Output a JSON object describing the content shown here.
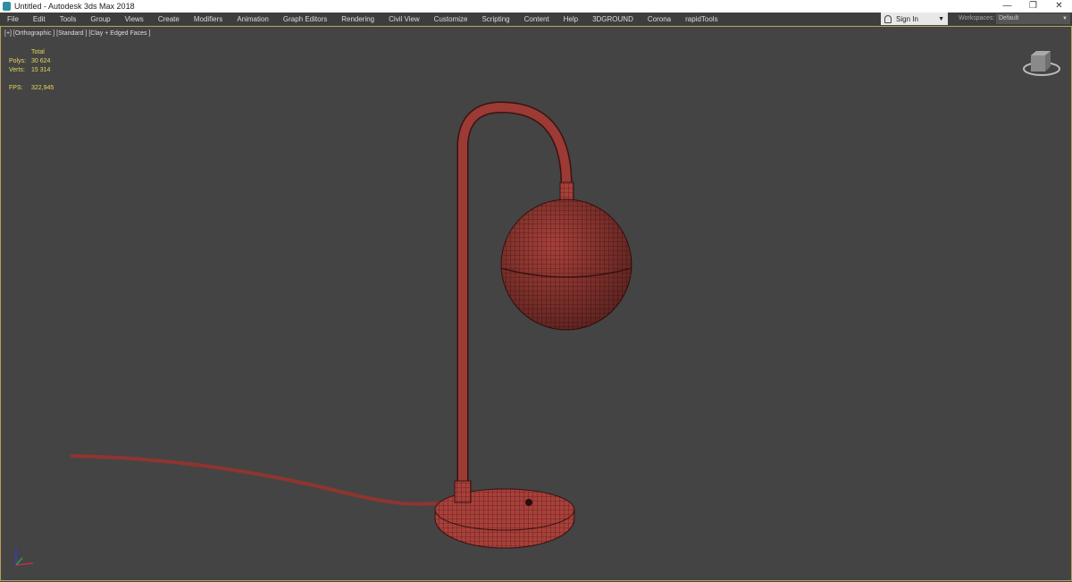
{
  "window": {
    "title": "Untitled - Autodesk 3ds Max 2018",
    "controls": [
      "—",
      "❐",
      "✕"
    ]
  },
  "menu": [
    "File",
    "Edit",
    "Tools",
    "Group",
    "Views",
    "Create",
    "Modifiers",
    "Animation",
    "Graph Editors",
    "Rendering",
    "Civil View",
    "Customize",
    "Scripting",
    "Content",
    "Help",
    "3DGROUND",
    "Corona",
    "rapidTools"
  ],
  "account": {
    "sign_in": "Sign In",
    "workspaces_label": "Workspaces:",
    "workspace": "Default"
  },
  "viewport": {
    "label": "[+] [Orthographic ] [Standard ] [Clay + Edged Faces ]",
    "stats": {
      "header": "Total",
      "polys_label": "Polys:",
      "polys": "30 624",
      "verts_label": "Verts:",
      "verts": "15 314",
      "fps_label": "FPS:",
      "fps": "322,945"
    }
  },
  "colors": {
    "mesh": "#a8403a",
    "wire": "#3a1210",
    "stats": "#e6d85a",
    "viewport_bg": "#444444"
  }
}
